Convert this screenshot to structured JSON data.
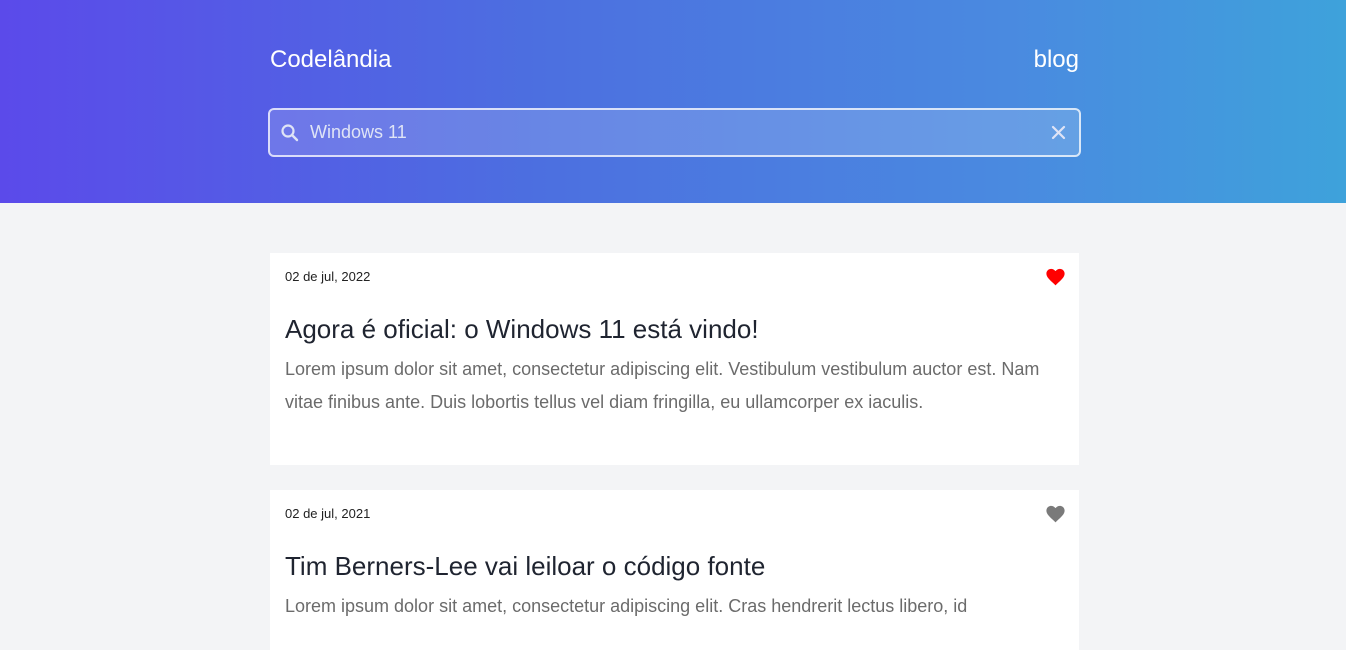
{
  "header": {
    "brand": "Codelândia",
    "nav_link": "blog",
    "gradient_colors": [
      "#5b4aea",
      "#3ea2db"
    ]
  },
  "search": {
    "value": "Windows 11",
    "icon": "search-icon",
    "clear_icon": "close-icon"
  },
  "posts": [
    {
      "date": "02 de jul, 2022",
      "title": "Agora é oficial: o Windows 11 está vindo!",
      "excerpt": "Lorem ipsum dolor sit amet, consectetur adipiscing elit. Vestibulum vestibulum auctor est. Nam vitae finibus ante. Duis lobortis tellus vel diam fringilla, eu ullamcorper ex iaculis.",
      "liked": true,
      "heart_color": "#ff0000"
    },
    {
      "date": "02 de jul, 2021",
      "title": "Tim Berners-Lee vai leiloar o código fonte",
      "excerpt": "Lorem ipsum dolor sit amet, consectetur adipiscing elit. Cras hendrerit lectus libero, id",
      "liked": false,
      "heart_color": "#7a7a7a"
    }
  ]
}
